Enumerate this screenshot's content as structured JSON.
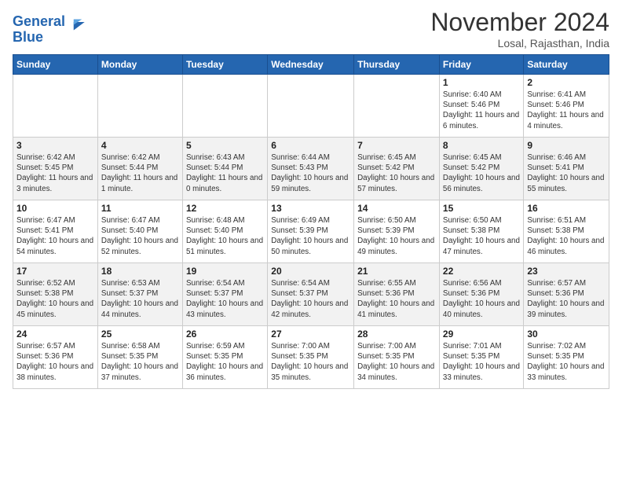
{
  "header": {
    "logo_line1": "General",
    "logo_line2": "Blue",
    "month_title": "November 2024",
    "location": "Losal, Rajasthan, India"
  },
  "calendar": {
    "days_of_week": [
      "Sunday",
      "Monday",
      "Tuesday",
      "Wednesday",
      "Thursday",
      "Friday",
      "Saturday"
    ],
    "weeks": [
      [
        {
          "day": "",
          "info": ""
        },
        {
          "day": "",
          "info": ""
        },
        {
          "day": "",
          "info": ""
        },
        {
          "day": "",
          "info": ""
        },
        {
          "day": "",
          "info": ""
        },
        {
          "day": "1",
          "info": "Sunrise: 6:40 AM\nSunset: 5:46 PM\nDaylight: 11 hours and 6 minutes."
        },
        {
          "day": "2",
          "info": "Sunrise: 6:41 AM\nSunset: 5:46 PM\nDaylight: 11 hours and 4 minutes."
        }
      ],
      [
        {
          "day": "3",
          "info": "Sunrise: 6:42 AM\nSunset: 5:45 PM\nDaylight: 11 hours and 3 minutes."
        },
        {
          "day": "4",
          "info": "Sunrise: 6:42 AM\nSunset: 5:44 PM\nDaylight: 11 hours and 1 minute."
        },
        {
          "day": "5",
          "info": "Sunrise: 6:43 AM\nSunset: 5:44 PM\nDaylight: 11 hours and 0 minutes."
        },
        {
          "day": "6",
          "info": "Sunrise: 6:44 AM\nSunset: 5:43 PM\nDaylight: 10 hours and 59 minutes."
        },
        {
          "day": "7",
          "info": "Sunrise: 6:45 AM\nSunset: 5:42 PM\nDaylight: 10 hours and 57 minutes."
        },
        {
          "day": "8",
          "info": "Sunrise: 6:45 AM\nSunset: 5:42 PM\nDaylight: 10 hours and 56 minutes."
        },
        {
          "day": "9",
          "info": "Sunrise: 6:46 AM\nSunset: 5:41 PM\nDaylight: 10 hours and 55 minutes."
        }
      ],
      [
        {
          "day": "10",
          "info": "Sunrise: 6:47 AM\nSunset: 5:41 PM\nDaylight: 10 hours and 54 minutes."
        },
        {
          "day": "11",
          "info": "Sunrise: 6:47 AM\nSunset: 5:40 PM\nDaylight: 10 hours and 52 minutes."
        },
        {
          "day": "12",
          "info": "Sunrise: 6:48 AM\nSunset: 5:40 PM\nDaylight: 10 hours and 51 minutes."
        },
        {
          "day": "13",
          "info": "Sunrise: 6:49 AM\nSunset: 5:39 PM\nDaylight: 10 hours and 50 minutes."
        },
        {
          "day": "14",
          "info": "Sunrise: 6:50 AM\nSunset: 5:39 PM\nDaylight: 10 hours and 49 minutes."
        },
        {
          "day": "15",
          "info": "Sunrise: 6:50 AM\nSunset: 5:38 PM\nDaylight: 10 hours and 47 minutes."
        },
        {
          "day": "16",
          "info": "Sunrise: 6:51 AM\nSunset: 5:38 PM\nDaylight: 10 hours and 46 minutes."
        }
      ],
      [
        {
          "day": "17",
          "info": "Sunrise: 6:52 AM\nSunset: 5:38 PM\nDaylight: 10 hours and 45 minutes."
        },
        {
          "day": "18",
          "info": "Sunrise: 6:53 AM\nSunset: 5:37 PM\nDaylight: 10 hours and 44 minutes."
        },
        {
          "day": "19",
          "info": "Sunrise: 6:54 AM\nSunset: 5:37 PM\nDaylight: 10 hours and 43 minutes."
        },
        {
          "day": "20",
          "info": "Sunrise: 6:54 AM\nSunset: 5:37 PM\nDaylight: 10 hours and 42 minutes."
        },
        {
          "day": "21",
          "info": "Sunrise: 6:55 AM\nSunset: 5:36 PM\nDaylight: 10 hours and 41 minutes."
        },
        {
          "day": "22",
          "info": "Sunrise: 6:56 AM\nSunset: 5:36 PM\nDaylight: 10 hours and 40 minutes."
        },
        {
          "day": "23",
          "info": "Sunrise: 6:57 AM\nSunset: 5:36 PM\nDaylight: 10 hours and 39 minutes."
        }
      ],
      [
        {
          "day": "24",
          "info": "Sunrise: 6:57 AM\nSunset: 5:36 PM\nDaylight: 10 hours and 38 minutes."
        },
        {
          "day": "25",
          "info": "Sunrise: 6:58 AM\nSunset: 5:35 PM\nDaylight: 10 hours and 37 minutes."
        },
        {
          "day": "26",
          "info": "Sunrise: 6:59 AM\nSunset: 5:35 PM\nDaylight: 10 hours and 36 minutes."
        },
        {
          "day": "27",
          "info": "Sunrise: 7:00 AM\nSunset: 5:35 PM\nDaylight: 10 hours and 35 minutes."
        },
        {
          "day": "28",
          "info": "Sunrise: 7:00 AM\nSunset: 5:35 PM\nDaylight: 10 hours and 34 minutes."
        },
        {
          "day": "29",
          "info": "Sunrise: 7:01 AM\nSunset: 5:35 PM\nDaylight: 10 hours and 33 minutes."
        },
        {
          "day": "30",
          "info": "Sunrise: 7:02 AM\nSunset: 5:35 PM\nDaylight: 10 hours and 33 minutes."
        }
      ]
    ]
  }
}
